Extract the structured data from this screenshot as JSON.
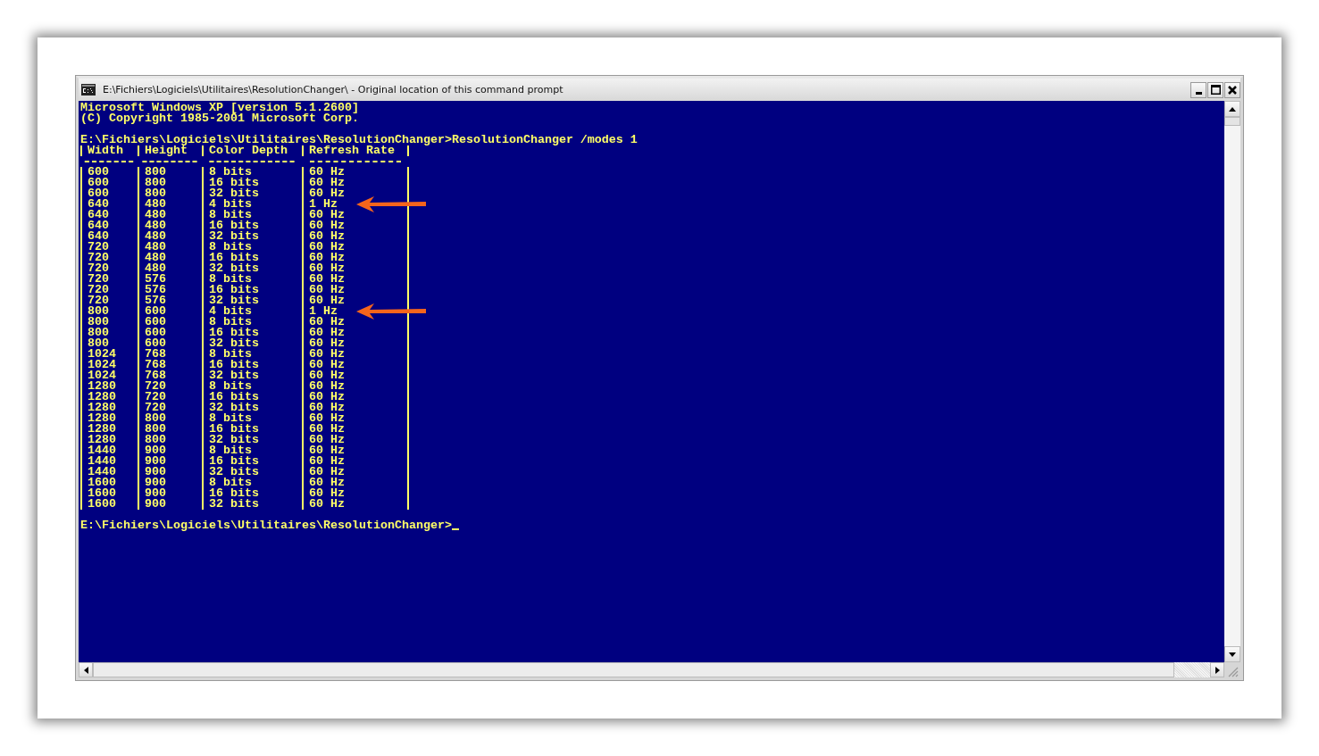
{
  "window": {
    "title": "E:\\Fichiers\\Logiciels\\Utilitaires\\ResolutionChanger\\ - Original location of this command prompt"
  },
  "console": {
    "lines": [
      "Microsoft Windows XP [version 5.1.2600]",
      "(C) Copyright 1985-2001 Microsoft Corp."
    ],
    "command_line": "E:\\Fichiers\\Logiciels\\Utilitaires\\ResolutionChanger>ResolutionChanger /modes 1",
    "table": {
      "columns": [
        "Width",
        "Height",
        "Color Depth",
        "Refresh Rate"
      ],
      "rows": [
        {
          "cells": [
            "600",
            "800",
            "8 bits",
            "60 Hz"
          ],
          "marked": false
        },
        {
          "cells": [
            "600",
            "800",
            "16 bits",
            "60 Hz"
          ],
          "marked": false
        },
        {
          "cells": [
            "600",
            "800",
            "32 bits",
            "60 Hz"
          ],
          "marked": false
        },
        {
          "cells": [
            "640",
            "480",
            "4 bits",
            "1 Hz"
          ],
          "marked": true
        },
        {
          "cells": [
            "640",
            "480",
            "8 bits",
            "60 Hz"
          ],
          "marked": false
        },
        {
          "cells": [
            "640",
            "480",
            "16 bits",
            "60 Hz"
          ],
          "marked": false
        },
        {
          "cells": [
            "640",
            "480",
            "32 bits",
            "60 Hz"
          ],
          "marked": false
        },
        {
          "cells": [
            "720",
            "480",
            "8 bits",
            "60 Hz"
          ],
          "marked": false
        },
        {
          "cells": [
            "720",
            "480",
            "16 bits",
            "60 Hz"
          ],
          "marked": false
        },
        {
          "cells": [
            "720",
            "480",
            "32 bits",
            "60 Hz"
          ],
          "marked": false
        },
        {
          "cells": [
            "720",
            "576",
            "8 bits",
            "60 Hz"
          ],
          "marked": false
        },
        {
          "cells": [
            "720",
            "576",
            "16 bits",
            "60 Hz"
          ],
          "marked": false
        },
        {
          "cells": [
            "720",
            "576",
            "32 bits",
            "60 Hz"
          ],
          "marked": false
        },
        {
          "cells": [
            "800",
            "600",
            "4 bits",
            "1 Hz"
          ],
          "marked": true
        },
        {
          "cells": [
            "800",
            "600",
            "8 bits",
            "60 Hz"
          ],
          "marked": false
        },
        {
          "cells": [
            "800",
            "600",
            "16 bits",
            "60 Hz"
          ],
          "marked": false
        },
        {
          "cells": [
            "800",
            "600",
            "32 bits",
            "60 Hz"
          ],
          "marked": false
        },
        {
          "cells": [
            "1024",
            "768",
            "8 bits",
            "60 Hz"
          ],
          "marked": false
        },
        {
          "cells": [
            "1024",
            "768",
            "16 bits",
            "60 Hz"
          ],
          "marked": false
        },
        {
          "cells": [
            "1024",
            "768",
            "32 bits",
            "60 Hz"
          ],
          "marked": false
        },
        {
          "cells": [
            "1280",
            "720",
            "8 bits",
            "60 Hz"
          ],
          "marked": false
        },
        {
          "cells": [
            "1280",
            "720",
            "16 bits",
            "60 Hz"
          ],
          "marked": false
        },
        {
          "cells": [
            "1280",
            "720",
            "32 bits",
            "60 Hz"
          ],
          "marked": false
        },
        {
          "cells": [
            "1280",
            "800",
            "8 bits",
            "60 Hz"
          ],
          "marked": false
        },
        {
          "cells": [
            "1280",
            "800",
            "16 bits",
            "60 Hz"
          ],
          "marked": false
        },
        {
          "cells": [
            "1280",
            "800",
            "32 bits",
            "60 Hz"
          ],
          "marked": false
        },
        {
          "cells": [
            "1440",
            "900",
            "8 bits",
            "60 Hz"
          ],
          "marked": false
        },
        {
          "cells": [
            "1440",
            "900",
            "16 bits",
            "60 Hz"
          ],
          "marked": false
        },
        {
          "cells": [
            "1440",
            "900",
            "32 bits",
            "60 Hz"
          ],
          "marked": false
        },
        {
          "cells": [
            "1600",
            "900",
            "8 bits",
            "60 Hz"
          ],
          "marked": false
        },
        {
          "cells": [
            "1600",
            "900",
            "16 bits",
            "60 Hz"
          ],
          "marked": false
        },
        {
          "cells": [
            "1600",
            "900",
            "32 bits",
            "60 Hz"
          ],
          "marked": false
        }
      ]
    },
    "prompt": "E:\\Fichiers\\Logiciels\\Utilitaires\\ResolutionChanger>"
  }
}
